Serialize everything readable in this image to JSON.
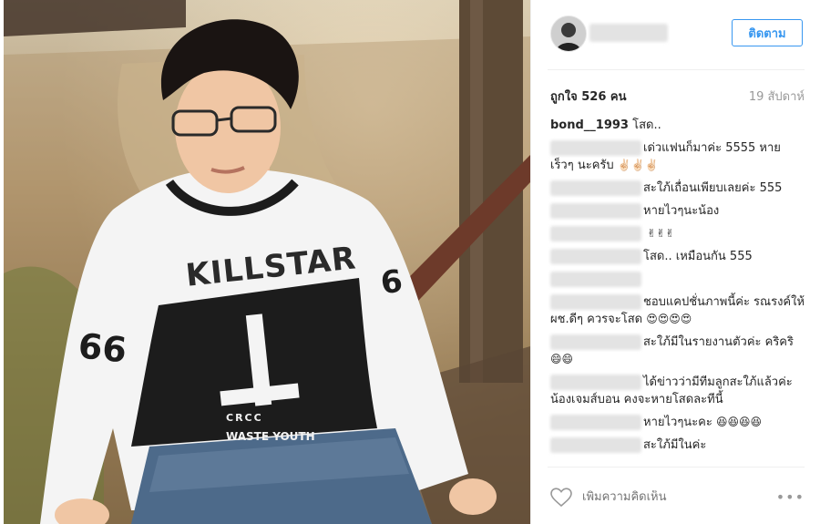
{
  "post": {
    "follow_label": "ติดตาม",
    "likes_text": "ถูกใจ 526 คน",
    "time_text": "19 สัปดาห์",
    "caption": {
      "username": "bond__1993",
      "text": "โสด.."
    },
    "comments": [
      {
        "text": "เด่วแฟนก็มาค่ะ 5555 หาย เร็วๆ นะครับ",
        "emoji": "✌🏻✌🏻✌🏻"
      },
      {
        "text": "สะใภ้เถื่อนเพียบเลยค่ะ 555",
        "emoji": ""
      },
      {
        "text": "หายไวๆนะน้อง",
        "emoji": ""
      },
      {
        "text": "",
        "emoji": "✌✌✌"
      },
      {
        "text": "โสด.. เหมือนกัน 555",
        "emoji": ""
      },
      {
        "text": "",
        "emoji": ""
      },
      {
        "text": "ชอบแคปชั่นภาพนี้ค่ะ รณรงค์ให้ ผช.ดีๆ ควรจะโสด",
        "emoji": "😍😍😍😍"
      },
      {
        "text": "สะใภ้มีในรายงานตัวค่ะ คริคริ",
        "emoji": "😄😄"
      },
      {
        "text": "ได้ข่าวว่ามีทีมลูกสะใภ้แล้วค่ะ น้องเจมส์บอน คงจะหายโสดละทีนี้",
        "emoji": ""
      },
      {
        "text": "หายไวๆนะคะ",
        "emoji": "😆😆😆😆"
      },
      {
        "text": "สะใภ้มีในค่ะ",
        "emoji": ""
      }
    ],
    "add_comment_placeholder": "เพิ่มความคิดเห็น",
    "more_label": "•••"
  },
  "photo": {
    "shirt_main": "KILLSTAR",
    "shirt_number": "66",
    "shirt_small": "CRCC",
    "shirt_bottom": "WASTE YOUTH",
    "shirt_sleeve": "6"
  },
  "icons": {
    "like": "heart-icon",
    "more": "more-options-icon"
  },
  "colors": {
    "accent": "#3897f0",
    "muted": "#999999",
    "text": "#262626"
  }
}
